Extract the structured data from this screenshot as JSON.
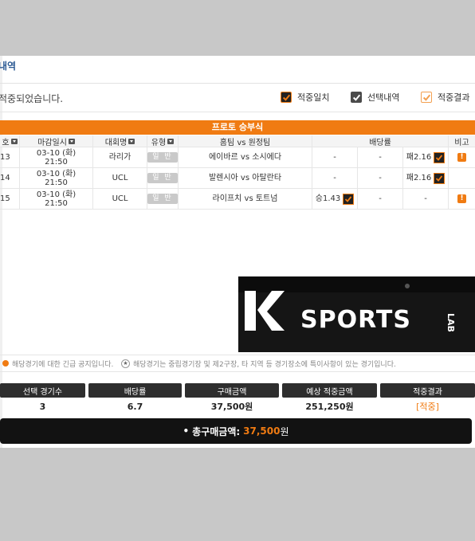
{
  "header": {
    "title": "내역"
  },
  "notice": {
    "message": "적중되었습니다."
  },
  "legend": [
    {
      "label": "적중일치",
      "kind": "match"
    },
    {
      "label": "선택내역",
      "kind": "select"
    },
    {
      "label": "적중결과",
      "kind": "result"
    }
  ],
  "game_title": "프로토 승부식",
  "columns": {
    "no": "호",
    "deadline": "마감일시",
    "league": "대회명",
    "type": "유형",
    "teams": "홈팀 vs 원정팀",
    "odds": "배당률",
    "note": "비고"
  },
  "rows": [
    {
      "no": "13",
      "date": "03-10 (화)",
      "time": "21:50",
      "league": "라리가",
      "type": "일 반",
      "match": "에이바르 vs 소시에다",
      "odd1": "-",
      "odd2": "-",
      "pick": "패2.16",
      "pick_col": 3,
      "note_icon": "alert-icon"
    },
    {
      "no": "14",
      "date": "03-10 (화)",
      "time": "21:50",
      "league": "UCL",
      "type": "일 반",
      "match": "발렌시아 vs 아탈란타",
      "odd1": "-",
      "odd2": "-",
      "pick": "패2.16",
      "pick_col": 3,
      "note_icon": "alert-icon"
    },
    {
      "no": "15",
      "date": "03-10 (화)",
      "time": "21:50",
      "league": "UCL",
      "type": "일 반",
      "match": "라이프치 vs 토트넘",
      "odd1": "-",
      "odd2": "-",
      "pick": "승1.43",
      "pick_col": 1,
      "note_icon": "alert-icon"
    }
  ],
  "logo": {
    "text_k": "K",
    "text_sports": "SPORTS",
    "text_lab": "LAB"
  },
  "footer_notes": {
    "n1": "해당경기에 대한 긴급 공지입니다.",
    "n2": "해당경기는 중립경기장 및 제2구장, 타 지역 등 경기장소에 특이사항이 있는 경기입니다."
  },
  "summary": {
    "headers": [
      "선택 경기수",
      "배당률",
      "구매금액",
      "예상 적중금액",
      "적중결과"
    ],
    "values": [
      "3",
      "6.7",
      "37,500원",
      "251,250원",
      "[적중]"
    ]
  },
  "total": {
    "label": "총구매금액:",
    "amount": "37,500",
    "unit": "원"
  },
  "colors": {
    "accent": "#f07b12",
    "dark": "#2e2e2e",
    "title_blue": "#2c5a93"
  }
}
